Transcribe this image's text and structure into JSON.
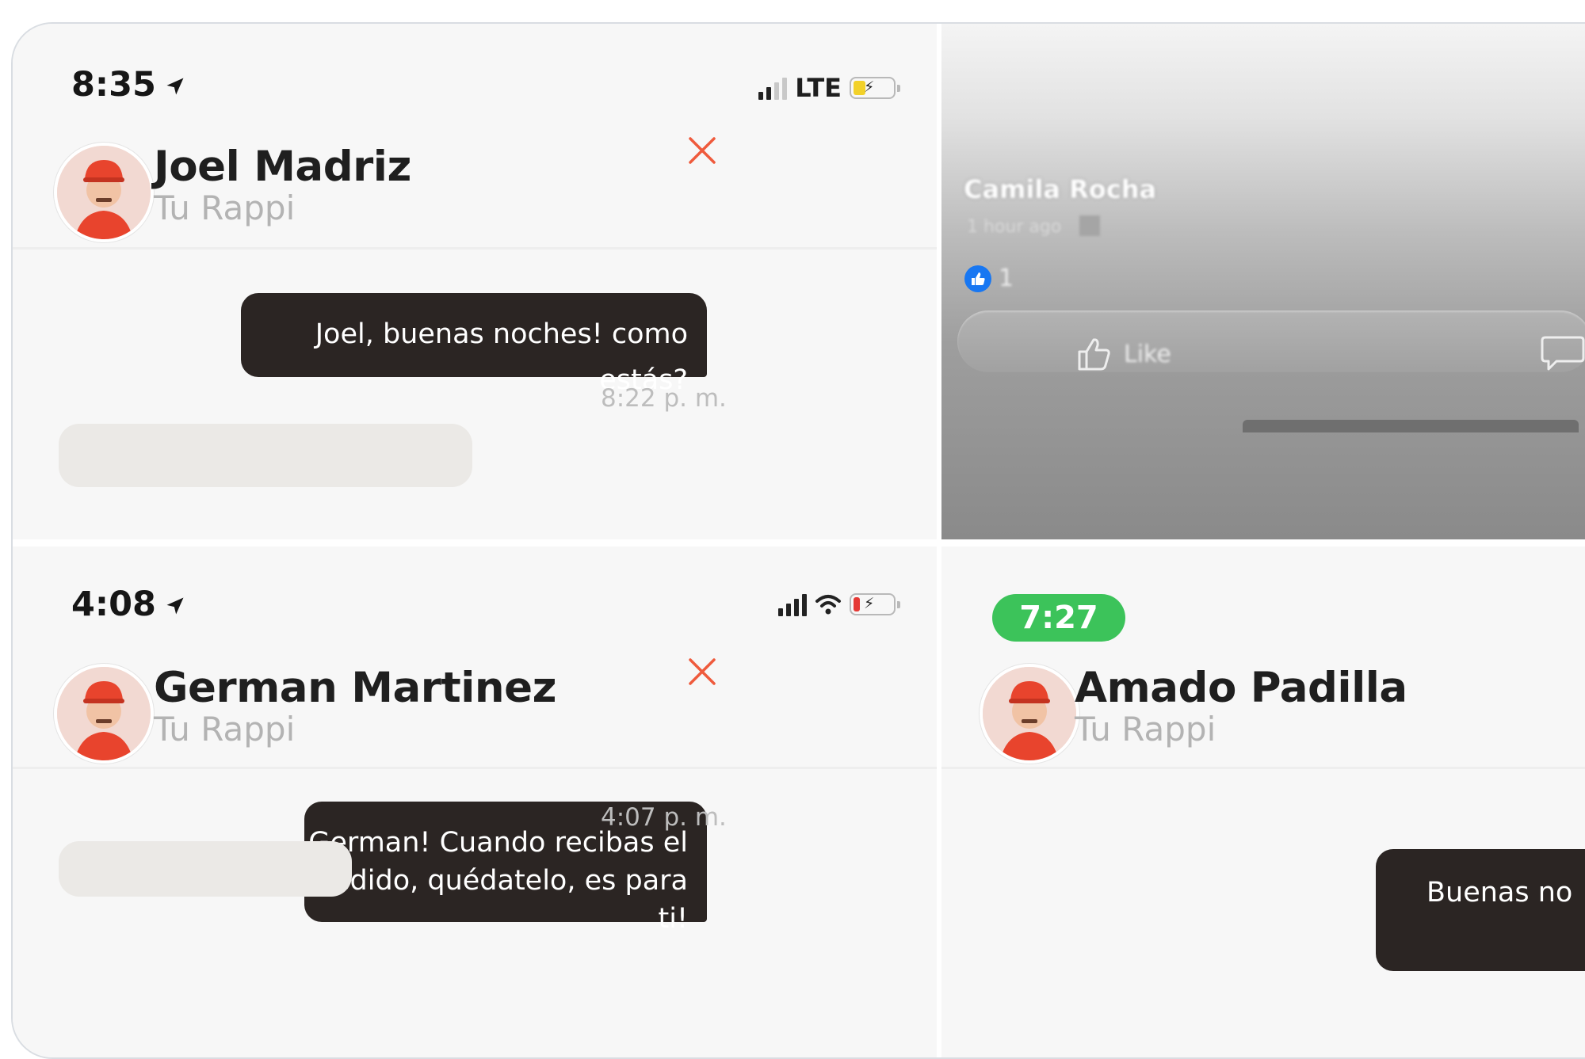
{
  "panels": {
    "joel": {
      "status_time": "8:35",
      "network_label": "LTE",
      "name": "Joel Madriz",
      "subtitle": "Tu Rappi",
      "message": "Joel, buenas noches! como estás?",
      "message_time": "8:22 p. m.",
      "battery_color": "#f2d12a"
    },
    "facebook_post": {
      "author": "Camila Rocha",
      "meta_text": "1 hour ago",
      "reaction_count": "1",
      "like_label": "Like"
    },
    "german": {
      "status_time": "4:08",
      "name": "German Martinez",
      "subtitle": "Tu Rappi",
      "message_line1": "German! Cuando recibas el",
      "message_line2": "pedido, quédatelo, es para ti!",
      "message_time": "4:07 p. m.",
      "battery_color": "#e53935"
    },
    "amado": {
      "status_time": "7:27",
      "name": "Amado Padilla",
      "subtitle": "Tu Rappi",
      "message_partial": "Buenas no",
      "time_pill_color": "#3cc35a"
    }
  },
  "colors": {
    "accent_close": "#ef5a3c",
    "bubble_dark": "#2b2523",
    "subtitle_gray": "#b3b3b3",
    "facebook_blue": "#1877f2"
  },
  "icons": [
    "location-arrow-icon",
    "signal-icon",
    "wifi-icon",
    "battery-icon",
    "close-icon",
    "thumbs-up-icon",
    "comment-icon"
  ]
}
